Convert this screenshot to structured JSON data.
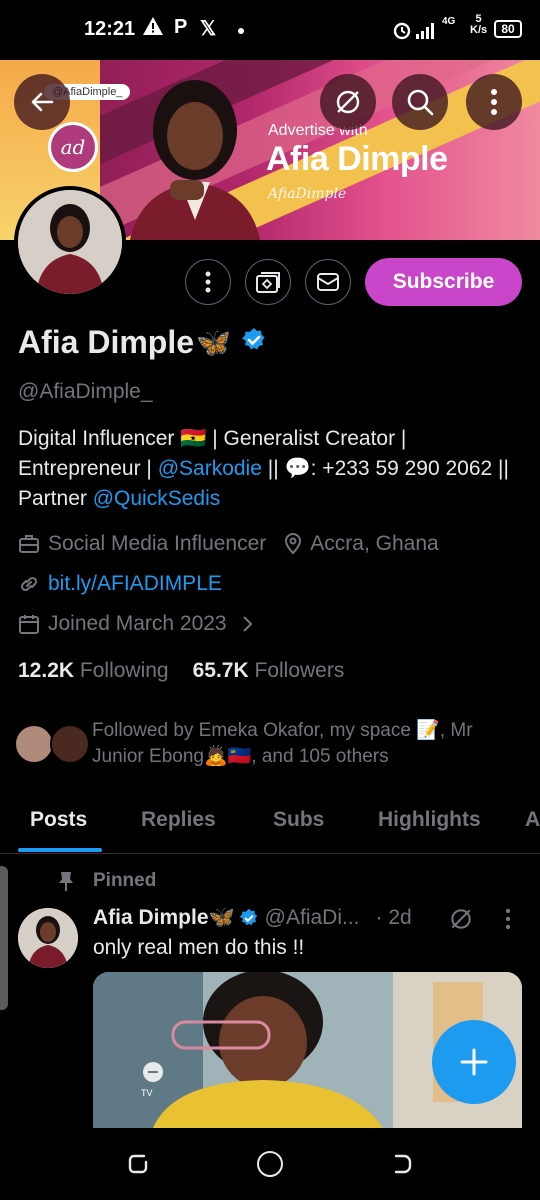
{
  "status_bar": {
    "time": "12:21",
    "network_label": "4G",
    "speed_value": "5",
    "speed_unit": "K/s",
    "battery": "80"
  },
  "banner": {
    "handle_tag": "@AfiaDimple_",
    "advertise_line1": "Advertise with",
    "advertise_line2": "Afia Dimple",
    "logo_text": "ad",
    "signature": "AfiaDimple"
  },
  "profile": {
    "name": "Afia Dimple",
    "name_emoji": "🦋",
    "handle": "@AfiaDimple_",
    "subscribe_label": "Subscribe",
    "bio": {
      "part1": "Digital Influencer 🇬🇭 | Generalist Creator | Entrepreneur | ",
      "mention1": "@Sarkodie",
      "part2": " || 💬: +233 59 290 2062 || Partner ",
      "mention2": "@QuickSedis"
    },
    "profession": "Social Media Influencer",
    "location": "Accra, Ghana",
    "website": "bit.ly/AFIADIMPLE",
    "joined": "Joined March 2023",
    "following_count": "12.2K",
    "following_label": "Following",
    "followers_count": "65.7K",
    "followers_label": "Followers",
    "followed_by": "Followed by Emeka Okafor, my space 📝, Mr Junior Ebong🙇🇱🇮, and 105 others"
  },
  "tabs": [
    "Posts",
    "Replies",
    "Subs",
    "Highlights",
    "A"
  ],
  "pinned_post": {
    "pinned_label": "Pinned",
    "author": "Afia Dimple🦋",
    "handle": "@AfiaDi...",
    "time": "· 2d",
    "text": "only real men do this !!",
    "video_tv_label": "TV"
  },
  "colors": {
    "accent": "#1d9bf0",
    "subscribe": "#c945c9",
    "background": "#000000",
    "muted": "#71767b"
  }
}
